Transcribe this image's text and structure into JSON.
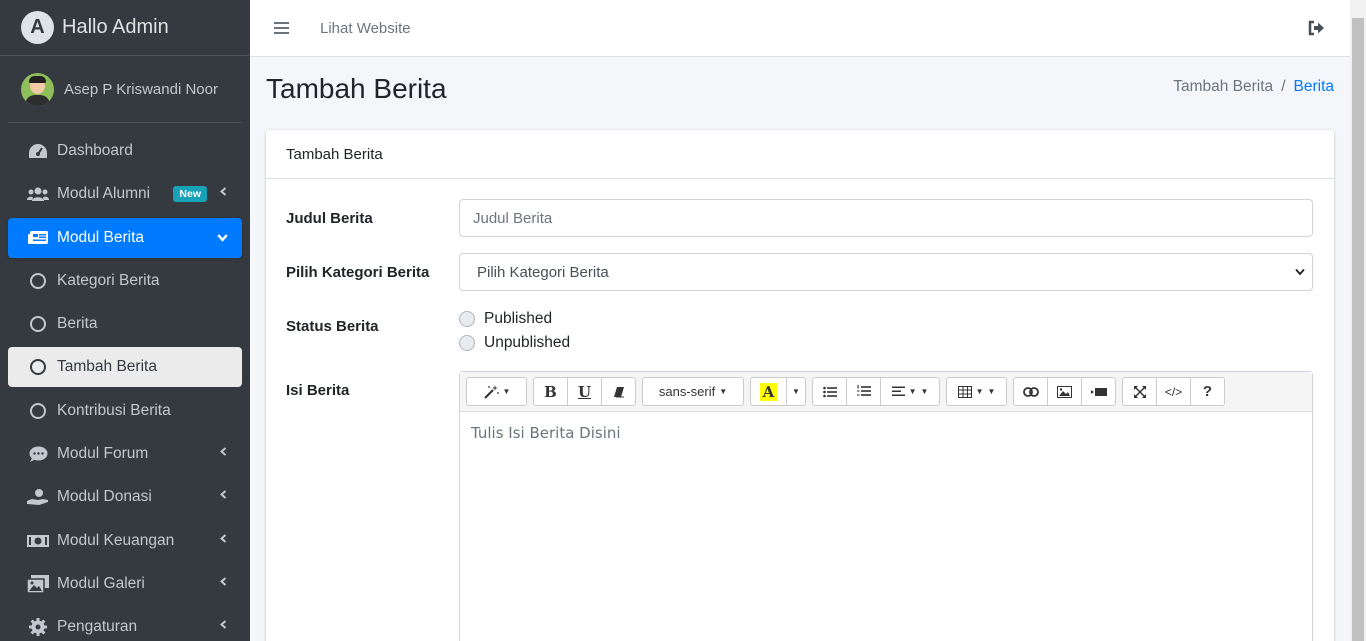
{
  "brand": {
    "title": "Hallo Admin",
    "logo_letter": "A"
  },
  "user": {
    "name": "Asep P Kriswandi Noor"
  },
  "sidebar": {
    "items": [
      {
        "label": "Dashboard",
        "icon": "tachometer-icon"
      },
      {
        "label": "Modul Alumni",
        "icon": "users-icon",
        "badge": "New"
      },
      {
        "label": "Modul Berita",
        "icon": "newspaper-icon"
      },
      {
        "label": "Kategori Berita",
        "icon": "circle-icon"
      },
      {
        "label": "Berita",
        "icon": "circle-icon"
      },
      {
        "label": "Tambah Berita",
        "icon": "circle-icon"
      },
      {
        "label": "Kontribusi Berita",
        "icon": "circle-icon"
      },
      {
        "label": "Modul Forum",
        "icon": "comment-icon"
      },
      {
        "label": "Modul Donasi",
        "icon": "hand-holding-usd-icon"
      },
      {
        "label": "Modul Keuangan",
        "icon": "money-bill-icon"
      },
      {
        "label": "Modul Galeri",
        "icon": "images-icon"
      },
      {
        "label": "Pengaturan",
        "icon": "cog-icon"
      }
    ]
  },
  "topbar": {
    "link": "Lihat Website"
  },
  "page": {
    "title": "Tambah Berita",
    "breadcrumb": {
      "current": "Tambah Berita",
      "separator": "/",
      "parent": "Berita"
    }
  },
  "card": {
    "header": "Tambah Berita",
    "fields": {
      "judul": {
        "label": "Judul Berita",
        "placeholder": "Judul Berita"
      },
      "kategori": {
        "label": "Pilih Kategori Berita",
        "selected": "Pilih Kategori Berita"
      },
      "status": {
        "label": "Status Berita",
        "options": [
          "Published",
          "Unpublished"
        ]
      },
      "isi": {
        "label": "Isi Berita",
        "placeholder": "Tulis Isi Berita Disini"
      }
    }
  },
  "editor": {
    "font_family": "sans-serif",
    "bold": "B",
    "underline": "U",
    "color_letter": "A",
    "help": "?",
    "code": "</>"
  },
  "colors": {
    "primary": "#007bff",
    "sidebar_bg": "#343a40",
    "badge": "#17a2b8",
    "highlight": "#ffff00"
  }
}
